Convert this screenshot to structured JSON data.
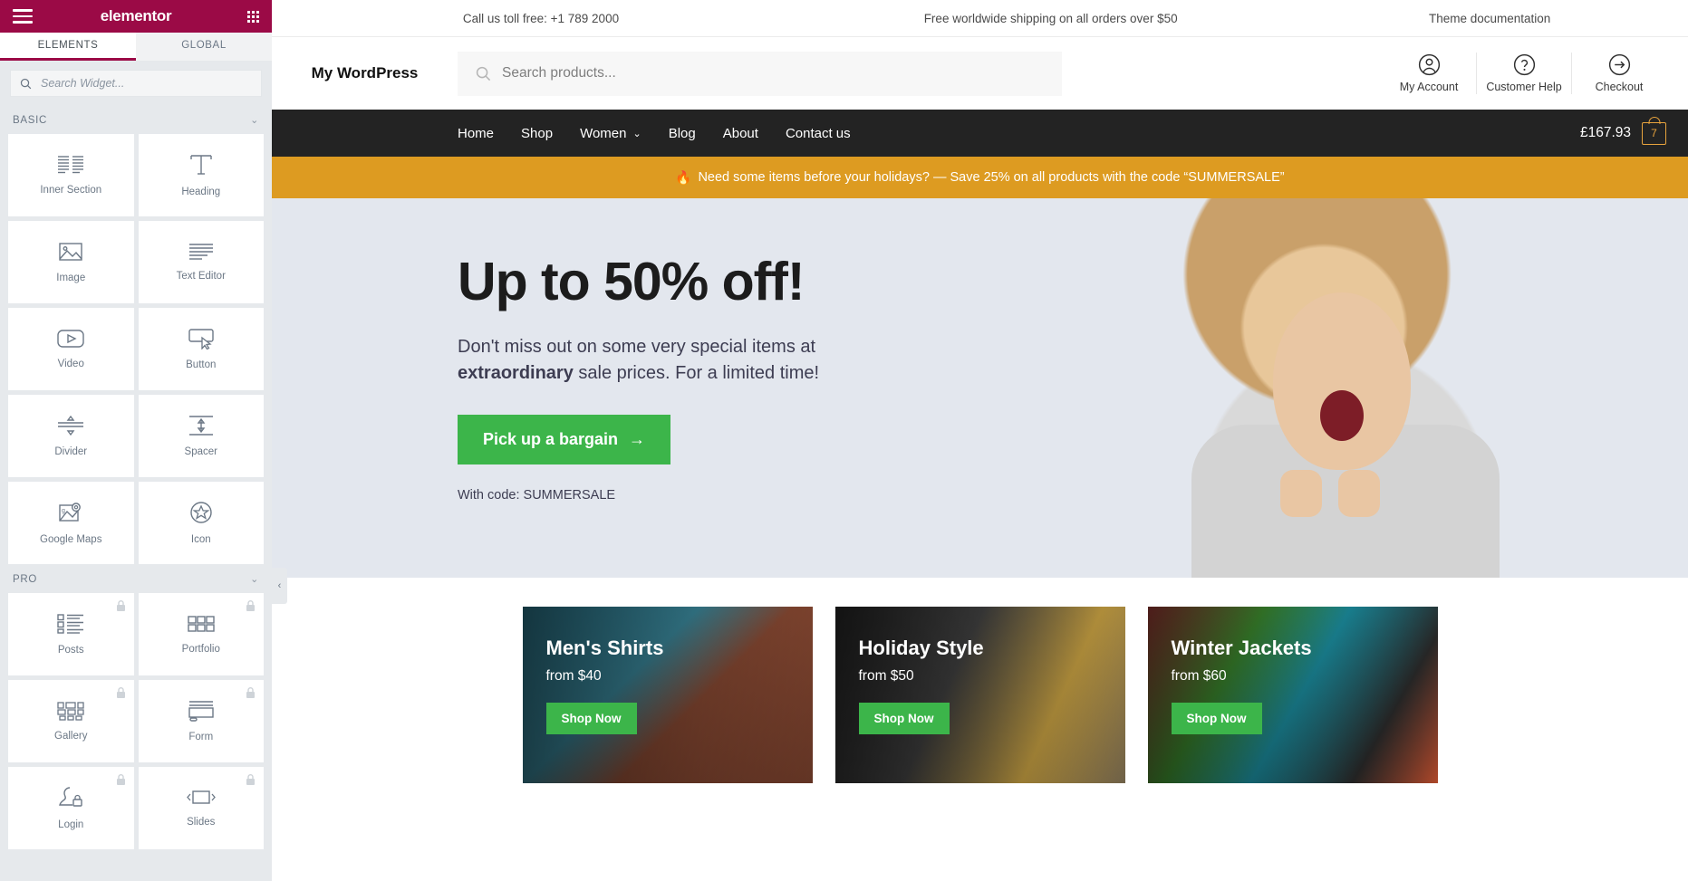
{
  "panel": {
    "brand": "elementor",
    "tabs": [
      {
        "label": "ELEMENTS",
        "active": true
      },
      {
        "label": "GLOBAL",
        "active": false
      }
    ],
    "search": {
      "placeholder": "Search Widget...",
      "value": ""
    },
    "categories": [
      {
        "title": "BASIC",
        "widgets": [
          {
            "label": "Inner Section",
            "icon": "inner-section-icon",
            "pro": false
          },
          {
            "label": "Heading",
            "icon": "heading-icon",
            "pro": false
          },
          {
            "label": "Image",
            "icon": "image-icon",
            "pro": false
          },
          {
            "label": "Text Editor",
            "icon": "text-editor-icon",
            "pro": false
          },
          {
            "label": "Video",
            "icon": "video-icon",
            "pro": false
          },
          {
            "label": "Button",
            "icon": "button-icon",
            "pro": false
          },
          {
            "label": "Divider",
            "icon": "divider-icon",
            "pro": false
          },
          {
            "label": "Spacer",
            "icon": "spacer-icon",
            "pro": false
          },
          {
            "label": "Google Maps",
            "icon": "google-maps-icon",
            "pro": false
          },
          {
            "label": "Icon",
            "icon": "star-icon",
            "pro": false
          }
        ]
      },
      {
        "title": "PRO",
        "widgets": [
          {
            "label": "Posts",
            "icon": "posts-icon",
            "pro": true
          },
          {
            "label": "Portfolio",
            "icon": "portfolio-icon",
            "pro": true
          },
          {
            "label": "Gallery",
            "icon": "gallery-icon",
            "pro": true
          },
          {
            "label": "Form",
            "icon": "form-icon",
            "pro": true
          },
          {
            "label": "Login",
            "icon": "login-icon",
            "pro": true
          },
          {
            "label": "Slides",
            "icon": "slides-icon",
            "pro": true
          }
        ]
      }
    ]
  },
  "site": {
    "topbar": [
      "Call us toll free: +1 789 2000",
      "Free worldwide shipping on all orders over $50",
      "Theme documentation"
    ],
    "logo": "My WordPress",
    "search_placeholder": "Search products...",
    "actions": [
      {
        "label": "My Account",
        "icon": "user-circle-icon"
      },
      {
        "label": "Customer Help",
        "icon": "question-circle-icon"
      },
      {
        "label": "Checkout",
        "icon": "arrow-right-circle-icon"
      }
    ],
    "nav": [
      {
        "label": "Home",
        "has_dropdown": false
      },
      {
        "label": "Shop",
        "has_dropdown": false
      },
      {
        "label": "Women",
        "has_dropdown": true
      },
      {
        "label": "Blog",
        "has_dropdown": false
      },
      {
        "label": "About",
        "has_dropdown": false
      },
      {
        "label": "Contact us",
        "has_dropdown": false
      }
    ],
    "cart": {
      "total": "£167.93",
      "count": "7",
      "accent": "#e8a33d"
    },
    "promo": {
      "emoji": "🔥",
      "text": "Need some items before your holidays? — Save 25% on all products with the code “SUMMERSALE”",
      "background": "#dd9b21"
    },
    "hero": {
      "title": "Up to 50% off!",
      "subtitle_a": "Don't miss out on some very special items at ",
      "subtitle_b": "extraordinary",
      "subtitle_c": " sale prices. For a limited time!",
      "cta": "Pick up a bargain",
      "cta_arrow": "→",
      "note": "With code: SUMMERSALE",
      "cta_color": "#3cb54a",
      "background": "#e3e7ee"
    },
    "cards": [
      {
        "title": "Men's Shirts",
        "from": "from $40",
        "button": "Shop Now"
      },
      {
        "title": "Holiday Style",
        "from": "from $50",
        "button": "Shop Now"
      },
      {
        "title": "Winter Jackets",
        "from": "from $60",
        "button": "Shop Now"
      }
    ]
  }
}
